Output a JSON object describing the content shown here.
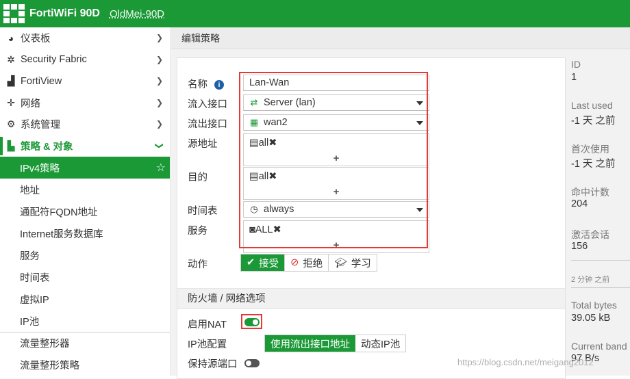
{
  "header": {
    "product": "FortiWiFi 90D",
    "hostname": "OldMei-90D"
  },
  "sidebar": {
    "items": [
      {
        "label": "仪表板",
        "icon": "dashboard-icon"
      },
      {
        "label": "Security Fabric",
        "icon": "fabric-icon"
      },
      {
        "label": "FortiView",
        "icon": "chart-icon"
      },
      {
        "label": "网络",
        "icon": "network-icon"
      },
      {
        "label": "系统管理",
        "icon": "gear-icon"
      },
      {
        "label": "策略 & 对象",
        "icon": "policy-icon"
      }
    ],
    "subitems": [
      "IPv4策略",
      "地址",
      "通配符FQDN地址",
      "Internet服务数据库",
      "服务",
      "时间表",
      "虚拟IP",
      "IP池",
      "流量整形器",
      "流量整形策略"
    ]
  },
  "page": {
    "title": "编辑策略"
  },
  "form": {
    "name_label": "名称",
    "name_value": "Lan-Wan",
    "in_label": "流入接口",
    "in_value": "Server (lan)",
    "out_label": "流出接口",
    "out_value": "wan2",
    "src_label": "源地址",
    "src_value": "all",
    "dst_label": "目的",
    "dst_value": "all",
    "schedule_label": "时间表",
    "schedule_value": "always",
    "service_label": "服务",
    "service_value": "ALL",
    "plus": "+",
    "action_label": "动作",
    "actions": {
      "accept": "接受",
      "deny": "拒绝",
      "learn": "学习"
    },
    "section_title": "防火墙 / 网络选项",
    "nat_label": "启用NAT",
    "nat_enabled": true,
    "ippool_label": "IP池配置",
    "ippool_options": {
      "use_outgoing": "使用流出接口地址",
      "dynamic": "动态IP池"
    },
    "preserve_label": "保持源端口",
    "preserve_enabled": false
  },
  "stats": {
    "id_label": "ID",
    "id_value": "1",
    "last_used_label": "Last used",
    "last_used_value": "-1 天 之前",
    "first_used_label": "首次使用",
    "first_used_value": "-1 天 之前",
    "hit_label": "命中计数",
    "hit_value": "204",
    "sessions_label": "激活会话",
    "sessions_value": "156",
    "ago": "2 分钟 之前",
    "bytes_label": "Total bytes",
    "bytes_value": "39.05 kB",
    "bandwidth_label": "Current band",
    "bandwidth_value": "97 B/s"
  },
  "watermark": "https://blog.csdn.net/meigang2012",
  "colors": {
    "brand": "#1a9936",
    "highlight": "#e53935"
  }
}
